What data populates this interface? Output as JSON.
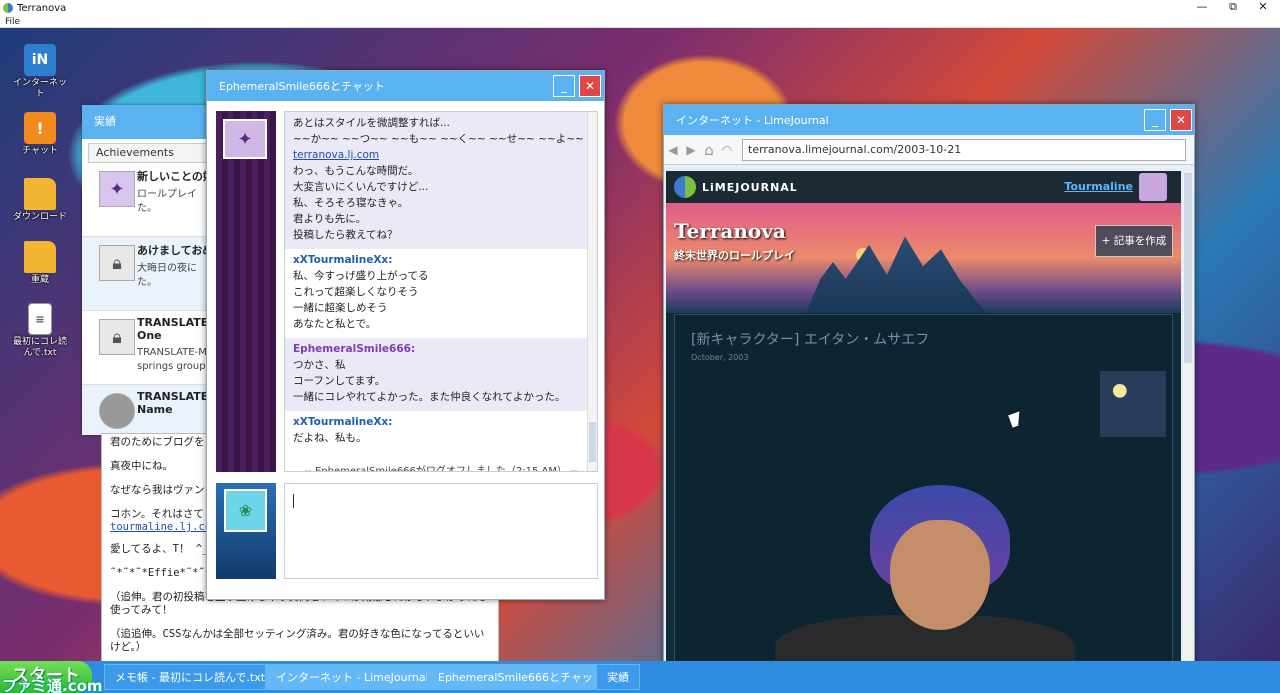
{
  "app": {
    "title": "Terranova",
    "menu": [
      "File"
    ],
    "controls": {
      "minimize": "—",
      "restore": "⧉",
      "close": "✕"
    }
  },
  "desktop": {
    "icons": [
      {
        "label": "インターネット",
        "icon": "internet-icon",
        "glyph": "iN",
        "color": "#2e7fd0"
      },
      {
        "label": "チャット",
        "icon": "chat-icon",
        "glyph": "!",
        "color": "#f28a1e"
      },
      {
        "label": "ダウンロード",
        "icon": "folder-icon",
        "glyph": "",
        "color": "#f2b632"
      },
      {
        "label": "重蔵",
        "icon": "folder-icon",
        "glyph": "",
        "color": "#f2b632"
      },
      {
        "label": "最初にコレ読んで.txt",
        "icon": "text-file-icon",
        "glyph": "≡",
        "color": "#ffffff"
      }
    ]
  },
  "achievements": {
    "title": "実績",
    "tab": "Achievements",
    "items": [
      {
        "title": "新しいことの始",
        "desc": "ロールプレイ",
        "desc2": "た。",
        "icon": "unlocked-avatar-icon"
      },
      {
        "title": "あけましておめ",
        "desc": "大晦日の夜に",
        "desc2": "た。",
        "icon": "lock-icon"
      },
      {
        "title": "TRANSLATE-M",
        "desc": "One",
        "desc2": "TRANSLATE-M",
        "desc3": "springs group",
        "icon": "lock-icon"
      },
      {
        "title": "TRANSLATE-M",
        "desc": "Name",
        "icon": "locked-cloud-icon"
      }
    ]
  },
  "notepad": {
    "lines": [
      "君のためにブログを",
      "真夜中にね。",
      "なぜなら我はヴァン",
      "コホン。それはさて",
      "愛してるよ、T！ ^_",
      "˜*˜*˜*Effie*˜*˜*˜",
      "（追伸。君の初投稿を盛り上げちゃう質問をいくつか用意したから、よかったら使ってみて！",
      "（追追伸。CSSなんかは全部セッティング済み。君の好きな色になってるといいけど。）"
    ],
    "link": "tourmaline.lj.com"
  },
  "chat": {
    "title": "EphemeralSmile666とチャット",
    "controls": {
      "minimize": "_",
      "close": "✕"
    },
    "blocks": [
      {
        "author": "",
        "lines": [
          "あとはスタイルを微調整すれば...",
          "~~か~~ ~~つ~~ ~~も~~ ~~く~~ ~~せ~~ ~~よ~~"
        ],
        "link": "terranova.lj.com",
        "lines2": [
          "わっ、もうこんな時間だ。",
          "大変言いにくいんですけど...",
          "私、そろそろ寝なきゃ。",
          "君よりも先に。",
          "投稿したら教えてね？"
        ],
        "alt": true
      },
      {
        "author": "xXTourmalineXx:",
        "color": "#1f5fb0",
        "lines": [
          "私、今すっげ盛り上がってる",
          "これって超楽しくなりそう",
          "一緒に超楽しめそう",
          "あなたと私とで。"
        ],
        "alt": false
      },
      {
        "author": "EphemeralSmile666:",
        "color": "#7a3fb0",
        "lines": [
          "つかさ、私",
          "コーフンしてます。",
          "一緒にコレやれてよかった。また仲良くなれてよかった。"
        ],
        "alt": true
      },
      {
        "author": "xXTourmalineXx:",
        "color": "#1f5fb0",
        "lines": [
          "だよね、私も。"
        ],
        "alt": false
      }
    ],
    "system": "-- EphemeralSmile666がログオフしました（2:15 AM） --",
    "input_value": ""
  },
  "browser": {
    "title": "インターネット - LimeJournal",
    "controls": {
      "minimize": "_",
      "close": "✕"
    },
    "address": "terranova.limejournal.com/2003-10-21",
    "nav": {
      "back": "◀",
      "forward": "▶",
      "home": "⌂",
      "rss": "◠"
    },
    "site": {
      "logo": "LiMEJOURNAL",
      "user": "Tourmaline",
      "blog_title": "Terranova",
      "blog_subtitle": "終末世界のロールプレイ",
      "new_post": "+ 記事を作成",
      "post_title": "[新キャラクター] エイタン・ムサエフ",
      "post_date": "October, 2003"
    }
  },
  "taskbar": {
    "start": "スタート",
    "watermark": "ファミ通.com",
    "items": [
      {
        "label": "メモ帳 - 最初にコレ読んで.txt",
        "active": false
      },
      {
        "label": "インターネット - LimeJournal",
        "active": true
      },
      {
        "label": "EphemeralSmile666とチャット",
        "active": true
      },
      {
        "label": "実績",
        "active": false
      }
    ]
  },
  "colors": {
    "titlebar": "#5ab2f0",
    "taskbar": "#2f8de0",
    "start": "#2fb534",
    "close": "#e04848"
  }
}
